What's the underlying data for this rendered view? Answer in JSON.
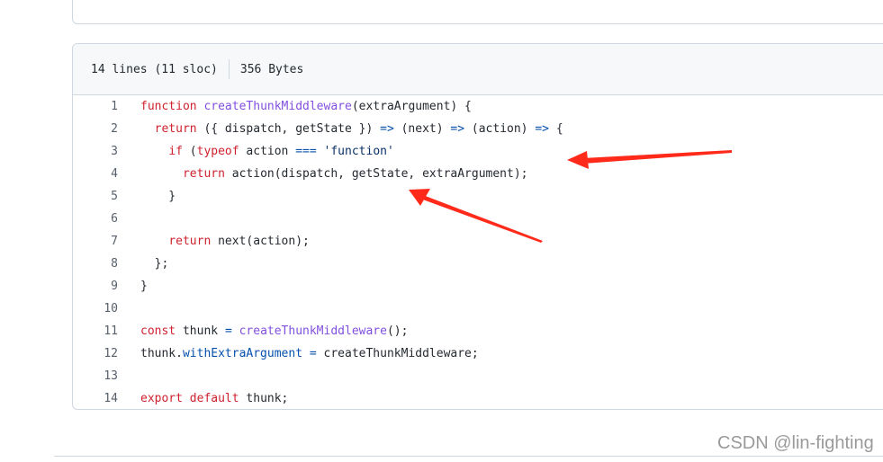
{
  "file_info": {
    "lines": "14 lines (11 sloc)",
    "size": "356 Bytes"
  },
  "colors": {
    "keyword": "#cf222e",
    "function": "#8250df",
    "property": "#0550ae",
    "string": "#0a3069",
    "annotation_arrow": "#ff2a1a"
  },
  "code_lines": [
    {
      "num": "1",
      "tokens": [
        [
          "kw",
          "function "
        ],
        [
          "fn",
          "createThunkMiddleware"
        ],
        [
          "",
          "(extraArgument) {"
        ]
      ]
    },
    {
      "num": "2",
      "tokens": [
        [
          "",
          "  "
        ],
        [
          "kw",
          "return"
        ],
        [
          "",
          " ({ dispatch, getState }) "
        ],
        [
          "pr",
          "=>"
        ],
        [
          "",
          " (next) "
        ],
        [
          "pr",
          "=>"
        ],
        [
          "",
          " (action) "
        ],
        [
          "pr",
          "=>"
        ],
        [
          "",
          " {"
        ]
      ]
    },
    {
      "num": "3",
      "tokens": [
        [
          "",
          "    "
        ],
        [
          "kw",
          "if"
        ],
        [
          "",
          " ("
        ],
        [
          "kw",
          "typeof"
        ],
        [
          "",
          " action "
        ],
        [
          "pr",
          "==="
        ],
        [
          "",
          " "
        ],
        [
          "st",
          "'function'"
        ],
        [
          ") {"
        ]
      ]
    },
    {
      "num": "4",
      "tokens": [
        [
          "",
          "      "
        ],
        [
          "kw",
          "return"
        ],
        [
          "",
          " action(dispatch, getState, extraArgument);"
        ]
      ]
    },
    {
      "num": "5",
      "tokens": [
        [
          "",
          "    }"
        ]
      ]
    },
    {
      "num": "6",
      "tokens": []
    },
    {
      "num": "7",
      "tokens": [
        [
          "",
          "    "
        ],
        [
          "kw",
          "return"
        ],
        [
          "",
          " next(action);"
        ]
      ]
    },
    {
      "num": "8",
      "tokens": [
        [
          "",
          "  };"
        ]
      ]
    },
    {
      "num": "9",
      "tokens": [
        [
          "",
          "}"
        ]
      ]
    },
    {
      "num": "10",
      "tokens": []
    },
    {
      "num": "11",
      "tokens": [
        [
          "kw",
          "const"
        ],
        [
          "",
          " thunk "
        ],
        [
          "pr",
          "="
        ],
        [
          "",
          " "
        ],
        [
          "fn",
          "createThunkMiddleware"
        ],
        [
          "",
          "();"
        ]
      ]
    },
    {
      "num": "12",
      "tokens": [
        [
          "",
          "thunk."
        ],
        [
          "pr",
          "withExtraArgument"
        ],
        [
          "",
          " "
        ],
        [
          "pr",
          "="
        ],
        [
          "",
          " createThunkMiddleware;"
        ]
      ]
    },
    {
      "num": "13",
      "tokens": []
    },
    {
      "num": "14",
      "tokens": [
        [
          "kw",
          "export"
        ],
        [
          "",
          " "
        ],
        [
          "kw",
          "default"
        ],
        [
          "",
          " thunk;"
        ]
      ]
    }
  ],
  "watermark": "CSDN @lin-fighting"
}
